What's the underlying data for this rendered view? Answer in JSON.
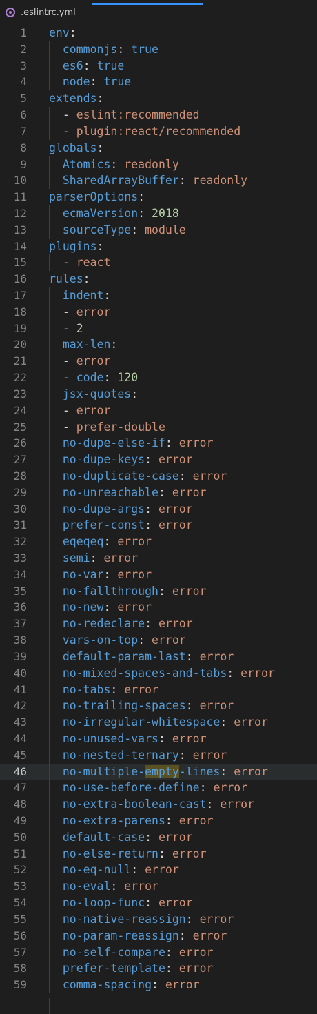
{
  "tab": {
    "filename": ".eslintrc.yml",
    "icon": "eslint-icon"
  },
  "lines": [
    {
      "n": "1",
      "key": "env",
      "kind": "section"
    },
    {
      "n": "2",
      "indent": true,
      "key": "commonjs",
      "val": "true",
      "vt": "b"
    },
    {
      "n": "3",
      "indent": true,
      "key": "es6",
      "val": "true",
      "vt": "b"
    },
    {
      "n": "4",
      "indent": true,
      "key": "node",
      "val": "true",
      "vt": "b"
    },
    {
      "n": "5",
      "key": "extends",
      "kind": "section"
    },
    {
      "n": "6",
      "indent": true,
      "item": "eslint:recommended",
      "vt": "s"
    },
    {
      "n": "7",
      "indent": true,
      "item": "plugin:react/recommended",
      "vt": "s"
    },
    {
      "n": "8",
      "key": "globals",
      "kind": "section"
    },
    {
      "n": "9",
      "indent": true,
      "key": "Atomics",
      "val": "readonly",
      "vt": "s"
    },
    {
      "n": "10",
      "indent": true,
      "key": "SharedArrayBuffer",
      "val": "readonly",
      "vt": "s"
    },
    {
      "n": "11",
      "key": "parserOptions",
      "kind": "section"
    },
    {
      "n": "12",
      "indent": true,
      "key": "ecmaVersion",
      "val": "2018",
      "vt": "n"
    },
    {
      "n": "13",
      "indent": true,
      "key": "sourceType",
      "val": "module",
      "vt": "s"
    },
    {
      "n": "14",
      "key": "plugins",
      "kind": "section"
    },
    {
      "n": "15",
      "indent": true,
      "item": "react",
      "vt": "s"
    },
    {
      "n": "16",
      "key": "rules",
      "kind": "section"
    },
    {
      "n": "17",
      "indent": true,
      "key": "indent",
      "kind": "section"
    },
    {
      "n": "18",
      "indent": true,
      "item": "error",
      "vt": "s"
    },
    {
      "n": "19",
      "indent": true,
      "item": "2",
      "vt": "n"
    },
    {
      "n": "20",
      "indent": true,
      "key": "max-len",
      "kind": "section"
    },
    {
      "n": "21",
      "indent": true,
      "item": "error",
      "vt": "s"
    },
    {
      "n": "22",
      "indent": true,
      "itemkey": "code",
      "val": "120",
      "vt": "n"
    },
    {
      "n": "23",
      "indent": true,
      "key": "jsx-quotes",
      "kind": "section"
    },
    {
      "n": "24",
      "indent": true,
      "item": "error",
      "vt": "s"
    },
    {
      "n": "25",
      "indent": true,
      "item": "prefer-double",
      "vt": "s"
    },
    {
      "n": "26",
      "indent": true,
      "key": "no-dupe-else-if",
      "val": "error",
      "vt": "s"
    },
    {
      "n": "27",
      "indent": true,
      "key": "no-dupe-keys",
      "val": "error",
      "vt": "s"
    },
    {
      "n": "28",
      "indent": true,
      "key": "no-duplicate-case",
      "val": "error",
      "vt": "s"
    },
    {
      "n": "29",
      "indent": true,
      "key": "no-unreachable",
      "val": "error",
      "vt": "s"
    },
    {
      "n": "30",
      "indent": true,
      "key": "no-dupe-args",
      "val": "error",
      "vt": "s"
    },
    {
      "n": "31",
      "indent": true,
      "key": "prefer-const",
      "val": "error",
      "vt": "s"
    },
    {
      "n": "32",
      "indent": true,
      "key": "eqeqeq",
      "val": "error",
      "vt": "s"
    },
    {
      "n": "33",
      "indent": true,
      "key": "semi",
      "val": "error",
      "vt": "s"
    },
    {
      "n": "34",
      "indent": true,
      "key": "no-var",
      "val": "error",
      "vt": "s"
    },
    {
      "n": "35",
      "indent": true,
      "key": "no-fallthrough",
      "val": "error",
      "vt": "s"
    },
    {
      "n": "36",
      "indent": true,
      "key": "no-new",
      "val": "error",
      "vt": "s"
    },
    {
      "n": "37",
      "indent": true,
      "key": "no-redeclare",
      "val": "error",
      "vt": "s"
    },
    {
      "n": "38",
      "indent": true,
      "key": "vars-on-top",
      "val": "error",
      "vt": "s"
    },
    {
      "n": "39",
      "indent": true,
      "key": "default-param-last",
      "val": "error",
      "vt": "s"
    },
    {
      "n": "40",
      "indent": true,
      "key": "no-mixed-spaces-and-tabs",
      "val": "error",
      "vt": "s"
    },
    {
      "n": "41",
      "indent": true,
      "key": "no-tabs",
      "val": "error",
      "vt": "s"
    },
    {
      "n": "42",
      "indent": true,
      "key": "no-trailing-spaces",
      "val": "error",
      "vt": "s"
    },
    {
      "n": "43",
      "indent": true,
      "key": "no-irregular-whitespace",
      "val": "error",
      "vt": "s"
    },
    {
      "n": "44",
      "indent": true,
      "key": "no-unused-vars",
      "val": "error",
      "vt": "s"
    },
    {
      "n": "45",
      "indent": true,
      "key": "no-nested-ternary",
      "val": "error",
      "vt": "s"
    },
    {
      "n": "46",
      "indent": true,
      "key": "no-multiple-empty-lines",
      "val": "error",
      "vt": "s",
      "current": true,
      "highlightWord": "empty"
    },
    {
      "n": "47",
      "indent": true,
      "key": "no-use-before-define",
      "val": "error",
      "vt": "s"
    },
    {
      "n": "48",
      "indent": true,
      "key": "no-extra-boolean-cast",
      "val": "error",
      "vt": "s"
    },
    {
      "n": "49",
      "indent": true,
      "key": "no-extra-parens",
      "val": "error",
      "vt": "s"
    },
    {
      "n": "50",
      "indent": true,
      "key": "default-case",
      "val": "error",
      "vt": "s"
    },
    {
      "n": "51",
      "indent": true,
      "key": "no-else-return",
      "val": "error",
      "vt": "s"
    },
    {
      "n": "52",
      "indent": true,
      "key": "no-eq-null",
      "val": "error",
      "vt": "s"
    },
    {
      "n": "53",
      "indent": true,
      "key": "no-eval",
      "val": "error",
      "vt": "s"
    },
    {
      "n": "54",
      "indent": true,
      "key": "no-loop-func",
      "val": "error",
      "vt": "s"
    },
    {
      "n": "55",
      "indent": true,
      "key": "no-native-reassign",
      "val": "error",
      "vt": "s"
    },
    {
      "n": "56",
      "indent": true,
      "key": "no-param-reassign",
      "val": "error",
      "vt": "s"
    },
    {
      "n": "57",
      "indent": true,
      "key": "no-self-compare",
      "val": "error",
      "vt": "s"
    },
    {
      "n": "58",
      "indent": true,
      "key": "prefer-template",
      "val": "error",
      "vt": "s"
    },
    {
      "n": "59",
      "indent": true,
      "key": "comma-spacing",
      "val": "error",
      "vt": "s"
    }
  ]
}
